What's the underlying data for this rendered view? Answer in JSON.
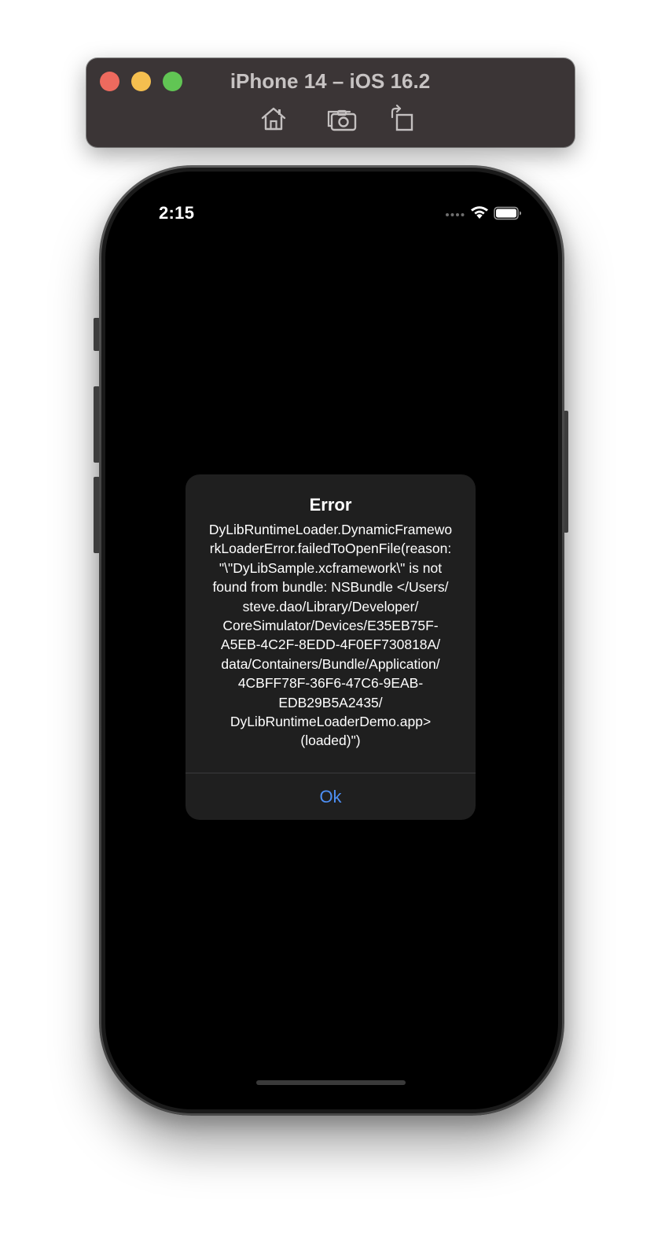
{
  "simulator": {
    "title": "iPhone 14 – iOS 16.2",
    "toolbar": {
      "home_icon": "home-icon",
      "screenshot_icon": "camera-icon",
      "rotate_icon": "rotate-icon"
    },
    "traffic_lights": {
      "close_color": "#ed6a5e",
      "minimize_color": "#f5bf4f",
      "maximize_color": "#61c554"
    }
  },
  "status_bar": {
    "time": "2:15",
    "icons": [
      "cellular-dots-icon",
      "wifi-icon",
      "battery-icon"
    ]
  },
  "alert": {
    "title": "Error",
    "message": "DyLibRuntimeLoader.DynamicFramewo\nrkLoaderError.failedToOpenFile(reason:\n\"\\\"DyLibSample.xcframework\\\" is not\nfound from bundle: NSBundle </Users/\nsteve.dao/Library/Developer/\nCoreSimulator/Devices/E35EB75F-\nA5EB-4C2F-8EDD-4F0EF730818A/\ndata/Containers/Bundle/Application/\n4CBFF78F-36F6-47C6-9EAB-\nEDB29B5A2435/\nDyLibRuntimeLoaderDemo.app>\n(loaded)\")",
    "button_label": "Ok",
    "button_color": "#4d8ff5"
  },
  "colors": {
    "screen_background": "#000000",
    "alert_background": "#1f1f1f",
    "titlebar_background": "#3b3536"
  }
}
